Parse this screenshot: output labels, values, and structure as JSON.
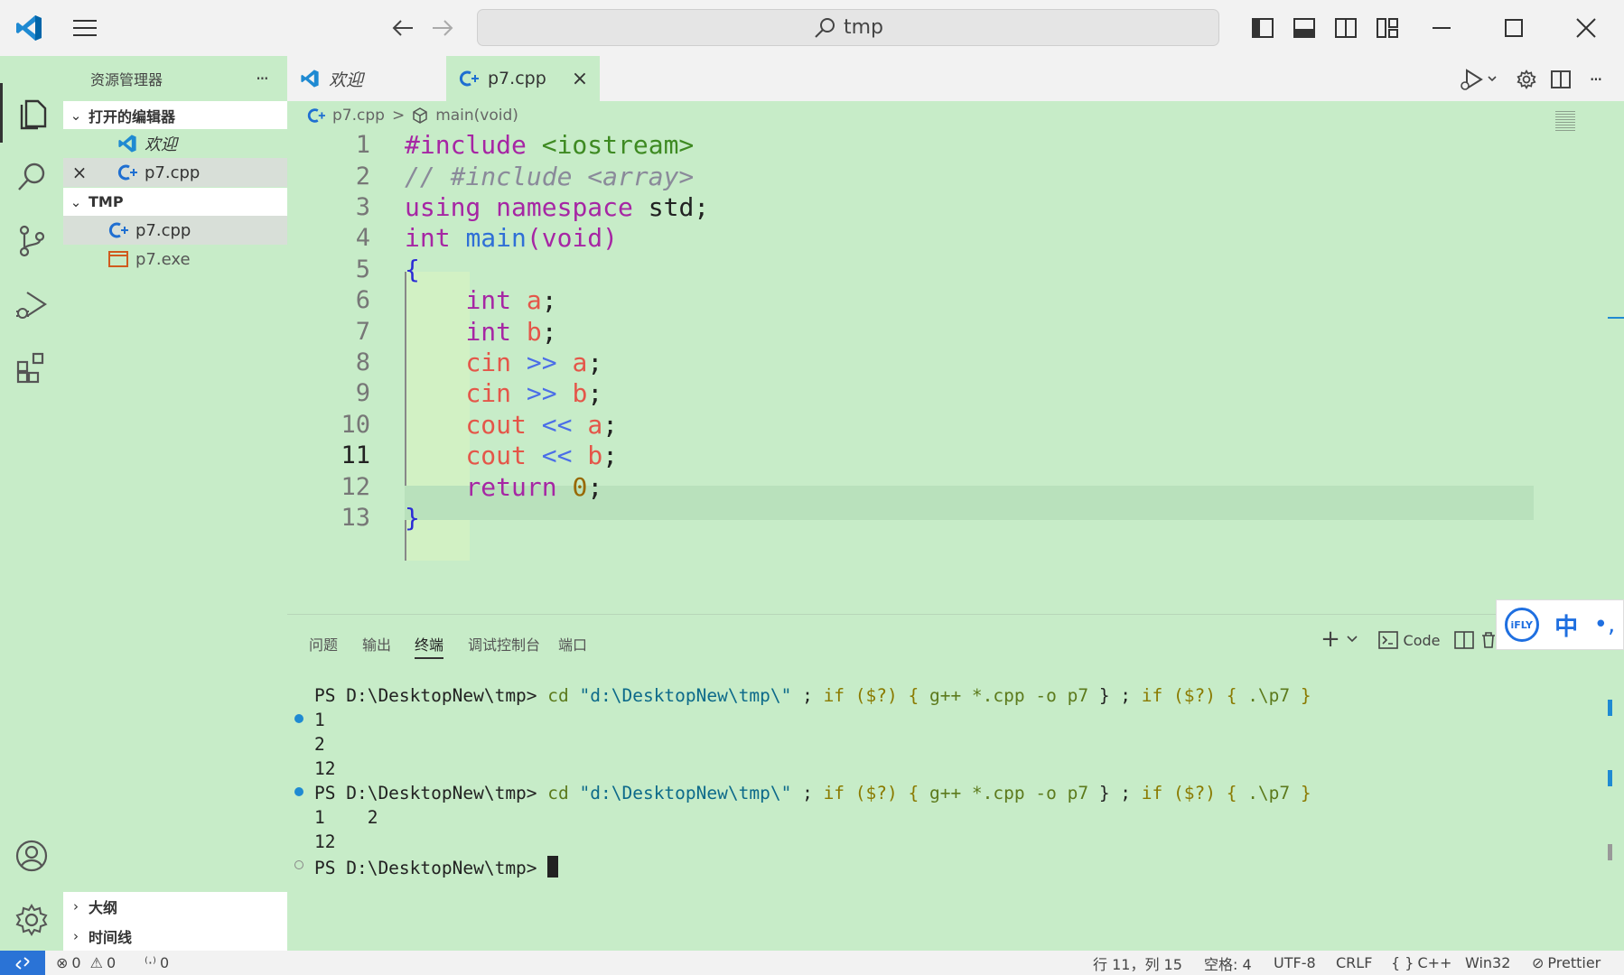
{
  "titlebar": {
    "search_text": "tmp"
  },
  "sidebar": {
    "title": "资源管理器",
    "more": "···",
    "open_editors_title": "打开的编辑器",
    "open_editors": [
      {
        "label": "欢迎",
        "italic": true
      },
      {
        "label": "p7.cpp",
        "close": "×"
      }
    ],
    "folder_title": "TMP",
    "files": [
      {
        "label": "p7.cpp"
      },
      {
        "label": "p7.exe"
      }
    ],
    "outline_title": "大纲",
    "timeline_title": "时间线"
  },
  "tabs": [
    {
      "label": "欢迎",
      "italic": true
    },
    {
      "label": "p7.cpp",
      "close": "×"
    }
  ],
  "breadcrumb": {
    "file": "p7.cpp",
    "sep": ">",
    "symbol": "main(void)"
  },
  "editor": {
    "current_line": 11,
    "line_numbers": [
      "1",
      "2",
      "3",
      "4",
      "5",
      "6",
      "7",
      "8",
      "9",
      "10",
      "11",
      "12",
      "13"
    ],
    "lines": [
      [
        [
          "#include ",
          "kw"
        ],
        [
          "<iostream>",
          "inc"
        ]
      ],
      [
        [
          "// #include <array>",
          "cmt"
        ]
      ],
      [
        [
          "using ",
          "kw"
        ],
        [
          "namespace ",
          "kw"
        ],
        [
          "std;",
          "plain"
        ]
      ],
      [
        [
          "int ",
          "kw"
        ],
        [
          "main",
          "fn"
        ],
        [
          "(void)",
          "kw"
        ]
      ],
      [
        [
          "{",
          "brace"
        ]
      ],
      [
        [
          "    ",
          "plain"
        ],
        [
          "int ",
          "kw"
        ],
        [
          "a",
          "var"
        ],
        [
          ";",
          "plain"
        ]
      ],
      [
        [
          "    ",
          "plain"
        ],
        [
          "int ",
          "kw"
        ],
        [
          "b",
          "var"
        ],
        [
          ";",
          "plain"
        ]
      ],
      [
        [
          "    ",
          "plain"
        ],
        [
          "cin ",
          "var"
        ],
        [
          ">> ",
          "op"
        ],
        [
          "a",
          "var"
        ],
        [
          ";",
          "plain"
        ]
      ],
      [
        [
          "    ",
          "plain"
        ],
        [
          "cin ",
          "var"
        ],
        [
          ">> ",
          "op"
        ],
        [
          "b",
          "var"
        ],
        [
          ";",
          "plain"
        ]
      ],
      [
        [
          "    ",
          "plain"
        ],
        [
          "cout ",
          "var"
        ],
        [
          "<< ",
          "op"
        ],
        [
          "a",
          "var"
        ],
        [
          ";",
          "plain"
        ]
      ],
      [
        [
          "    ",
          "plain"
        ],
        [
          "cout ",
          "var"
        ],
        [
          "<< ",
          "op"
        ],
        [
          "b",
          "var"
        ],
        [
          ";",
          "plain"
        ]
      ],
      [
        [
          "    ",
          "plain"
        ],
        [
          "return ",
          "kw"
        ],
        [
          "0",
          "num"
        ],
        [
          ";",
          "plain"
        ]
      ],
      [
        [
          "}",
          "brace"
        ]
      ]
    ]
  },
  "panel": {
    "tabs": [
      "问题",
      "输出",
      "终端",
      "调试控制台",
      "端口"
    ],
    "active_tab": "终端",
    "new_terminal": "+",
    "profile_label": "Code"
  },
  "terminal": {
    "prompt": "PS D:\\DesktopNew\\tmp> ",
    "cmd_cd": "cd ",
    "cmd_path": "\"d:\\DesktopNew\\tmp\\\"",
    "cmd_rest_1": " ; ",
    "kw_if": "if",
    "cmd_rest_2": " ($?) { ",
    "cmd_gpp": "g++ *.cpp -o p7",
    "cmd_rest_3": " } ; ",
    "cmd_rest_4": " ($?) { ",
    "cmd_run": ".\\p7",
    "cmd_rest_5": " }",
    "out1_a": "1",
    "out1_b": "2",
    "out1_c": "12",
    "out2_a": "1    2",
    "out2_b": "12"
  },
  "statusbar": {
    "errors": "0",
    "warnings": "0",
    "ports": "0",
    "position": "行 11，列 15",
    "spaces": "空格: 4",
    "encoding": "UTF-8",
    "eol": "CRLF",
    "language": "C++",
    "language_prefix": "{ }",
    "platform": "Win32",
    "formatter": "Prettier"
  },
  "ime": {
    "brand": "iFLY",
    "mode": "中"
  },
  "colors": {
    "background": "#c7ecc8",
    "accent": "#0065a9",
    "titlebar": "#f2f2f2"
  }
}
